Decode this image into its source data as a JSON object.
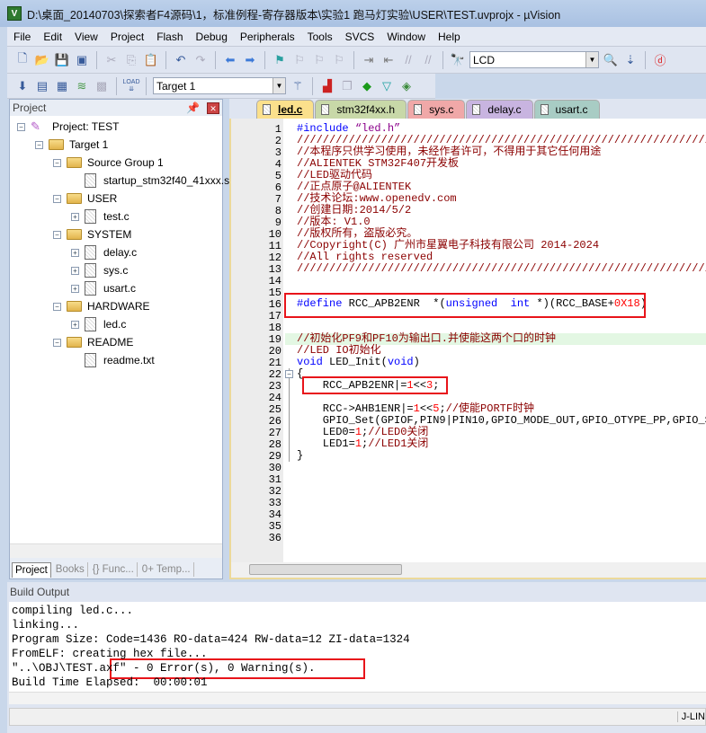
{
  "window": {
    "title": "D:\\桌面_20140703\\探索者F4源码\\1，标准例程-寄存器版本\\实验1 跑马灯实验\\USER\\TEST.uvprojx - µVision",
    "app_icon": "V"
  },
  "menu": [
    "File",
    "Edit",
    "View",
    "Project",
    "Flash",
    "Debug",
    "Peripherals",
    "Tools",
    "SVCS",
    "Window",
    "Help"
  ],
  "toolbar1": {
    "find_value": "LCD"
  },
  "toolbar2": {
    "target_value": "Target 1",
    "load_label": "LOAD"
  },
  "project": {
    "header": "Project",
    "tree": [
      {
        "label": "Project: TEST",
        "type": "project",
        "level": 0,
        "exp": "−"
      },
      {
        "label": "Target 1",
        "type": "target",
        "level": 1,
        "exp": "−"
      },
      {
        "label": "Source Group 1",
        "type": "folder",
        "level": 2,
        "exp": "−"
      },
      {
        "label": "startup_stm32f40_41xxx.s",
        "type": "file",
        "level": 3,
        "exp": ""
      },
      {
        "label": "USER",
        "type": "folder",
        "level": 2,
        "exp": "−"
      },
      {
        "label": "test.c",
        "type": "file",
        "level": 3,
        "exp": "+"
      },
      {
        "label": "SYSTEM",
        "type": "folder",
        "level": 2,
        "exp": "−"
      },
      {
        "label": "delay.c",
        "type": "file",
        "level": 3,
        "exp": "+"
      },
      {
        "label": "sys.c",
        "type": "file",
        "level": 3,
        "exp": "+"
      },
      {
        "label": "usart.c",
        "type": "file",
        "level": 3,
        "exp": "+"
      },
      {
        "label": "HARDWARE",
        "type": "folder",
        "level": 2,
        "exp": "−"
      },
      {
        "label": "led.c",
        "type": "file",
        "level": 3,
        "exp": "+"
      },
      {
        "label": "README",
        "type": "folder",
        "level": 2,
        "exp": "−"
      },
      {
        "label": "readme.txt",
        "type": "file",
        "level": 3,
        "exp": ""
      }
    ],
    "tabs": [
      "Project",
      "Books",
      "{} Func...",
      "0+ Temp..."
    ]
  },
  "editor": {
    "tabs": [
      {
        "label": "led.c",
        "color": "#fbe08c",
        "active": true
      },
      {
        "label": "stm32f4xx.h",
        "color": "#c8d8a8"
      },
      {
        "label": "sys.c",
        "color": "#f0a8a8"
      },
      {
        "label": "delay.c",
        "color": "#c8b4e0"
      },
      {
        "label": "usart.c",
        "color": "#a8ccc4"
      }
    ],
    "lines": [
      [
        [
          "kw",
          "#include "
        ],
        [
          "str",
          "“led.h”"
        ]
      ],
      [
        [
          "cm",
          "////////////////////////////////////////////////////////////////"
        ]
      ],
      [
        [
          "cm",
          "//本程序只供学习使用，未经作者许可，不得用于其它任何用途"
        ]
      ],
      [
        [
          "cm",
          "//ALIENTEK STM32F407开发板"
        ]
      ],
      [
        [
          "cm",
          "//LED驱动代码"
        ]
      ],
      [
        [
          "cm",
          "//正点原子@ALIENTEK"
        ]
      ],
      [
        [
          "cm",
          "//技术论坛:www.openedv.com"
        ]
      ],
      [
        [
          "cm",
          "//创建日期:2014/5/2"
        ]
      ],
      [
        [
          "cm",
          "//版本: V1.0"
        ]
      ],
      [
        [
          "cm",
          "//版权所有，盗版必究。"
        ]
      ],
      [
        [
          "cm",
          "//Copyright(C) 广州市星翼电子科技有限公司 2014-2024"
        ]
      ],
      [
        [
          "cm",
          "//All rights reserved"
        ]
      ],
      [
        [
          "cm",
          "////////////////////////////////////////////////////////////////"
        ]
      ],
      [],
      [],
      [
        [
          "kw",
          "#define"
        ],
        [
          "tx",
          " RCC_APB2ENR  *("
        ],
        [
          "kw",
          "unsigned"
        ],
        [
          "tx",
          "  "
        ],
        [
          "kw",
          "int"
        ],
        [
          "tx",
          " *)(RCC_BASE+"
        ],
        [
          "num",
          "0X18"
        ],
        [
          "tx",
          ")"
        ]
      ],
      [],
      [],
      [
        [
          "cm",
          "//初始化PF9和PF10为输出口.并使能这两个口的时钟"
        ]
      ],
      [
        [
          "cm",
          "//LED IO初始化"
        ]
      ],
      [
        [
          "kw",
          "void"
        ],
        [
          "tx",
          " LED_Init("
        ],
        [
          "kw",
          "void"
        ],
        [
          "tx",
          ")"
        ]
      ],
      [
        [
          "tx",
          "{"
        ]
      ],
      [
        [
          "tx",
          "    RCC_APB2ENR|="
        ],
        [
          "num",
          "1"
        ],
        [
          "tx",
          "<<"
        ],
        [
          "num",
          "3"
        ],
        [
          "tx",
          ";"
        ]
      ],
      [],
      [
        [
          "tx",
          "    RCC->AHB1ENR|="
        ],
        [
          "num",
          "1"
        ],
        [
          "tx",
          "<<"
        ],
        [
          "num",
          "5"
        ],
        [
          "tx",
          ";"
        ],
        [
          "cm",
          "//使能PORTF时钟"
        ]
      ],
      [
        [
          "tx",
          "    GPIO_Set(GPIOF,PIN9|PIN10,GPIO_MODE_OUT,GPIO_OTYPE_PP,GPIO_SP"
        ]
      ],
      [
        [
          "tx",
          "    LED0="
        ],
        [
          "num",
          "1"
        ],
        [
          "tx",
          ";"
        ],
        [
          "cm",
          "//LED0关闭"
        ]
      ],
      [
        [
          "tx",
          "    LED1="
        ],
        [
          "num",
          "1"
        ],
        [
          "tx",
          ";"
        ],
        [
          "cm",
          "//LED1关闭"
        ]
      ],
      [
        [
          "tx",
          "}"
        ]
      ],
      [],
      [],
      [],
      [],
      [],
      [],
      []
    ]
  },
  "build": {
    "header": "Build Output",
    "lines": [
      "compiling led.c...",
      "linking...",
      "Program Size: Code=1436 RO-data=424 RW-data=12 ZI-data=1324",
      "FromELF: creating hex file...",
      "\"..\\OBJ\\TEST.axf\" - 0 Error(s), 0 Warning(s).",
      "Build Time Elapsed:  00:00:01"
    ]
  },
  "status": {
    "debugger": "J-LIN"
  }
}
